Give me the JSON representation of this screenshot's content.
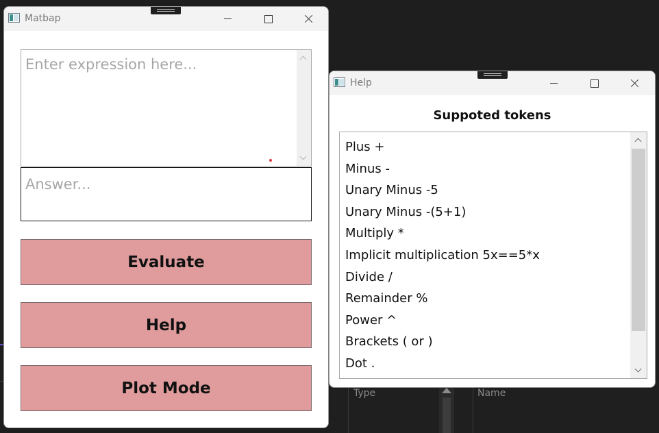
{
  "background": {
    "columns": [
      "Type",
      "Name"
    ]
  },
  "main_window": {
    "title": "Matbap",
    "expression_placeholder": "Enter expression here...",
    "answer_placeholder": "Answer...",
    "buttons": {
      "evaluate": "Evaluate",
      "help": "Help",
      "plot_mode": "Plot Mode"
    },
    "colors": {
      "button_bg": "#e09c9d"
    }
  },
  "help_window": {
    "title": "Help",
    "heading": "Suppoted tokens",
    "tokens": [
      "Plus +",
      "Minus -",
      "Unary Minus -5",
      "Unary Minus -(5+1)",
      "Multiply *",
      "Implicit multiplication 5x==5*x",
      "Divide /",
      "Remainder %",
      "Power ^",
      "Brackets ( or )",
      "Dot ."
    ]
  }
}
